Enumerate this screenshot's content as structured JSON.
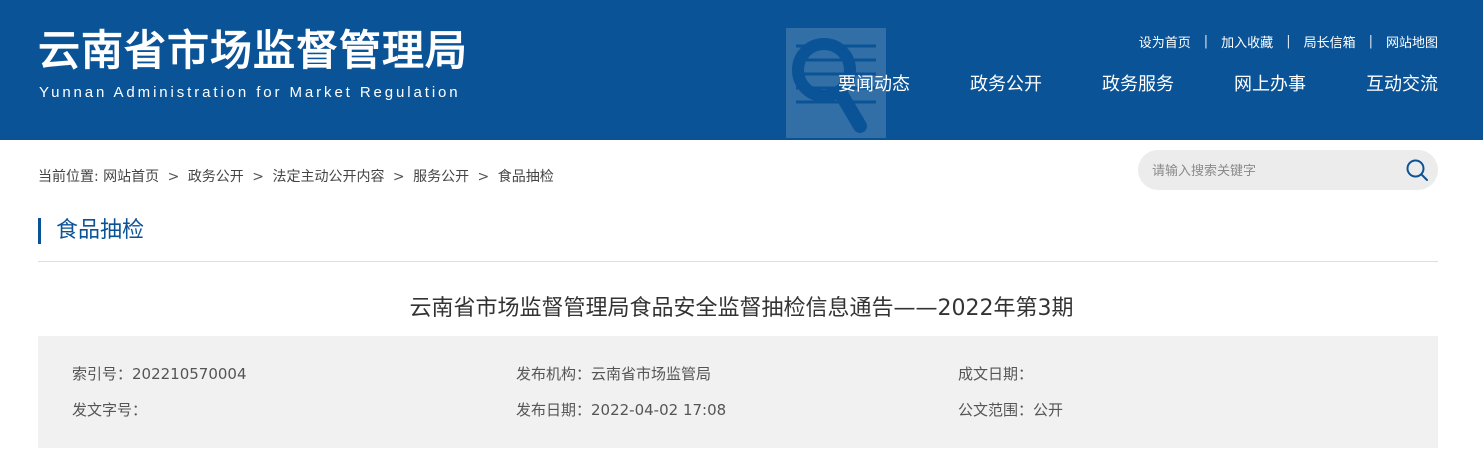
{
  "header": {
    "title": "云南省市场监督管理局",
    "subtitle": "Yunnan Administration for Market Regulation",
    "top_links": [
      "设为首页",
      "加入收藏",
      "局长信箱",
      "网站地图"
    ],
    "top_link_separator": "|",
    "nav": [
      "要闻动态",
      "政务公开",
      "政务服务",
      "网上办事",
      "互动交流"
    ],
    "colors": {
      "header_bg": "#0a5396",
      "accent": "#0a5396"
    }
  },
  "breadcrumb": {
    "prefix": "当前位置:",
    "items": [
      "网站首页",
      "政务公开",
      "法定主动公开内容",
      "服务公开",
      "食品抽检"
    ],
    "separator": ">"
  },
  "search": {
    "placeholder": "请输入搜索关键字",
    "icon": "search-icon"
  },
  "section": {
    "title": "食品抽检"
  },
  "article": {
    "title": "云南省市场监督管理局食品安全监督抽检信息通告——2022年第3期",
    "meta": {
      "index_no": "索引号：202210570004",
      "publisher": "发布机构：云南省市场监管局",
      "created_date": "成文日期：",
      "doc_no": "发文字号：",
      "publish_date": "发布日期：2022-04-02 17:08",
      "scope": "公文范围：公开"
    }
  }
}
